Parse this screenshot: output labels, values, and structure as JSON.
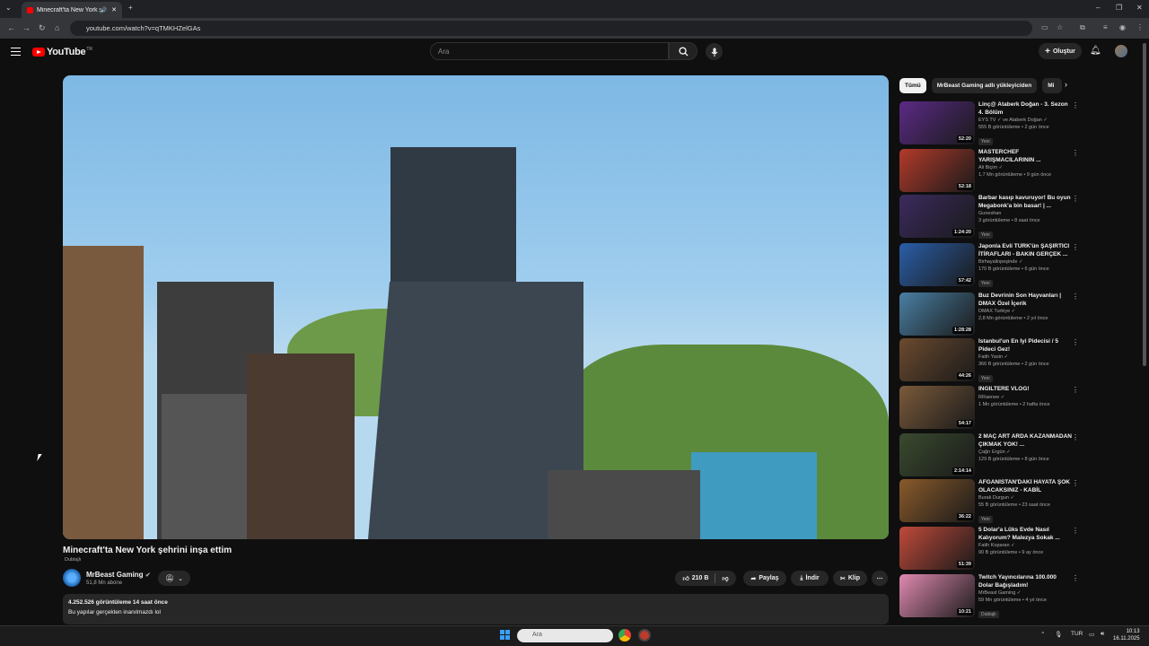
{
  "browser": {
    "tab_title": "Minecraft'ta New York şehri...",
    "url": "youtube.com/watch?v=qTMKHZelGAs"
  },
  "header": {
    "logo_text": "YouTube",
    "logo_region": "TR",
    "search_placeholder": "Ara",
    "create_label": "Oluştur"
  },
  "video": {
    "title": "Minecraft'ta New York şehrini inşa ettim",
    "dub_label": "Dublajlı",
    "channel": "MrBeast Gaming",
    "subscribers": "51,8 Mn abone",
    "likes": "210 B",
    "share_label": "Paylaş",
    "download_label": "İndir",
    "clip_label": "Klip",
    "views_line": "4.252.526 görüntüleme  14 saat önce",
    "description": "Bu yapılar gerçekten inanılmazdı lol"
  },
  "chips": [
    "Tümü",
    "MrBeast Gaming adlı yükleyiciden",
    "Mi"
  ],
  "recommendations": [
    {
      "title": "Linç@ Ataberk Doğan - 3. Sezon 4. Bölüm",
      "channel": "EYS TV ✓ ve Ataberk Doğan ✓",
      "meta": "555 B görüntüleme • 2 gün önce",
      "badge": "Yeni",
      "duration": "52:20",
      "color": "#5b2a86"
    },
    {
      "title": "MASTERCHEF YARIŞMACILARININ ...",
      "channel": "Ali Biçim ✓",
      "meta": "1,7 Mn görüntüleme • 9 gün önce",
      "badge": "",
      "duration": "52:18",
      "color": "#b33a2a"
    },
    {
      "title": "Barbar kasıp kavuruyor! Bu oyun Megabonk'a bin basar! | ...",
      "channel": "Guneshan",
      "meta": "3 görüntüleme • 8 saat önce",
      "badge": "Yeni",
      "duration": "1:24:20",
      "color": "#3b2a5e"
    },
    {
      "title": "Japonla Evli TÜRK'ün ŞAŞIRTICI İTİRAFLARI - BAKIN GERÇEK ...",
      "channel": "Birhayalinpeşinde ✓",
      "meta": "170 B görüntüleme • 6 gün önce",
      "badge": "Yeni",
      "duration": "57:42",
      "color": "#2a5ea8"
    },
    {
      "title": "Buz Devrinin Son Hayvanları | DMAX Özel İçerik",
      "channel": "DMAX Turkiye ✓",
      "meta": "2,8 Mn görüntüleme • 2 yıl önce",
      "badge": "",
      "duration": "1:28:28",
      "color": "#4a7fa3"
    },
    {
      "title": "İstanbul'un En İyi Pidecisi / 5 Pideci Gez!",
      "channel": "Fatih Yasin ✓",
      "meta": "366 B görüntüleme • 2 gün önce",
      "badge": "Yeni",
      "duration": "44:26",
      "color": "#6b4a2e"
    },
    {
      "title": "İNGİLTERE VLOG!",
      "channel": "RRaenee ✓",
      "meta": "1 Mn görüntüleme • 2 hafta önce",
      "badge": "",
      "duration": "54:17",
      "color": "#7a5a3a"
    },
    {
      "title": "2 MAÇ ART ARDA KAZANMADAN ÇIKMAK YOK! ...",
      "channel": "Çağrı Ergün ✓",
      "meta": "129 B görüntüleme • 8 gün önce",
      "badge": "",
      "duration": "2:14:14",
      "color": "#3a4a2e"
    },
    {
      "title": "AFGANİSTAN'DAKİ HAYATA ŞOK OLACAKSINIZ - KABİL",
      "channel": "Burak Durgun ✓",
      "meta": "55 B görüntüleme • 23 saat önce",
      "badge": "Yeni",
      "duration": "36:22",
      "color": "#8a5a2a"
    },
    {
      "title": "5 Dolar'a Lüks Evde Nasıl Kalıyorum? Malezya Sokak ...",
      "channel": "Fatih Koparan ✓",
      "meta": "90 B görüntüleme • 9 ay önce",
      "badge": "",
      "duration": "51:39",
      "color": "#c04a3a"
    },
    {
      "title": "Twitch Yayıncılarına 100.000 Dolar Bağışladım!",
      "channel": "MrBeast Gaming ✓",
      "meta": "59 Mn görüntüleme • 4 yıl önce",
      "badge": "Dublajlı",
      "duration": "10:21",
      "color": "#e08ab0"
    }
  ],
  "taskbar": {
    "search_placeholder": "Ara",
    "language": "TUR",
    "time": "10:13",
    "date": "16.11.2025"
  }
}
